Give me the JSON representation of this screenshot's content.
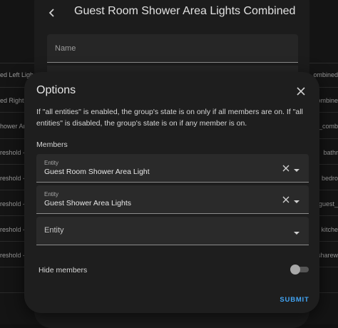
{
  "background": {
    "left_items": [
      "ed Left Ligh",
      "ed Right",
      "hower Ar",
      "reshold -",
      "reshold -",
      "reshold -",
      "reshold -",
      "reshold -"
    ],
    "right_items": [
      "ombined",
      "ombine",
      "_comb",
      "bathr",
      "bedro",
      "guest_",
      "kitche",
      "sharew"
    ]
  },
  "outer_dialog": {
    "title": "Guest Room Shower Area Lights Combined",
    "name_label": "Name"
  },
  "options_dialog": {
    "title": "Options",
    "description": "If \"all entities\" is enabled, the group's state is on only if all members are on. If \"all entities\" is disabled, the group's state is on if any member is on.",
    "members_label": "Members",
    "members": [
      {
        "label": "Entity",
        "value": "Guest Room Shower Area Light"
      },
      {
        "label": "Entity",
        "value": "Guest Shower Area Lights"
      }
    ],
    "empty_entity_placeholder": "Entity",
    "hide_members_label": "Hide members",
    "hide_members_enabled": false,
    "submit_label": "SUBMIT"
  },
  "colors": {
    "accent": "#42a5f5",
    "dialog_bg": "#1e1e1e",
    "field_bg": "#2a2a2a"
  },
  "icons": [
    "back-arrow-icon",
    "close-icon",
    "clear-icon",
    "dropdown-arrow-icon"
  ]
}
